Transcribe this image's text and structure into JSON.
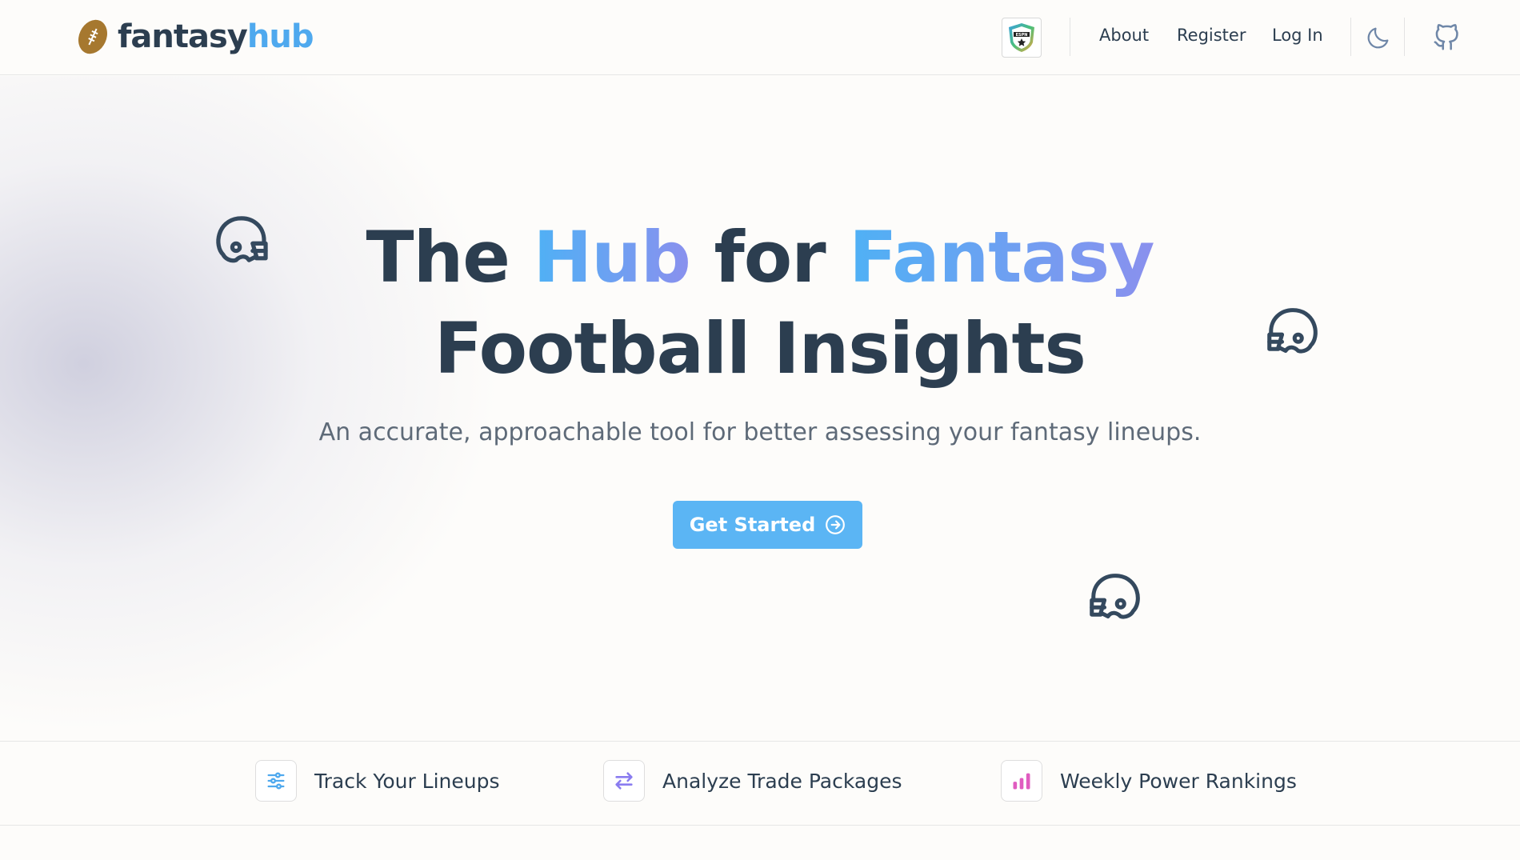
{
  "brand": {
    "name_part1": "fantasy",
    "name_part2": "hub"
  },
  "nav": {
    "links": [
      {
        "label": "About"
      },
      {
        "label": "Register"
      },
      {
        "label": "Log In"
      }
    ],
    "espn_icon": "espn-fantasy-shield-icon",
    "theme_icon": "moon-icon",
    "github_icon": "github-icon"
  },
  "hero": {
    "title_w1": "The",
    "title_w2": "Hub",
    "title_w3": "for",
    "title_w4": "Fantasy",
    "title_line2": "Football Insights",
    "subtitle": "An accurate, approachable tool for better assessing your fantasy lineups.",
    "cta_label": "Get Started",
    "cta_icon": "arrow-right-circle-icon",
    "decor_icons": [
      "football-helmet-icon",
      "football-helmet-icon",
      "football-helmet-icon"
    ]
  },
  "features": [
    {
      "label": "Track Your Lineups",
      "icon": "sliders-icon",
      "color": "#4fa9ee"
    },
    {
      "label": "Analyze Trade Packages",
      "icon": "arrows-swap-icon",
      "color": "#8a7cf0"
    },
    {
      "label": "Weekly Power Rankings",
      "icon": "bar-chart-icon",
      "color": "#e05cc0"
    }
  ],
  "colors": {
    "accent_blue": "#4fa9ee",
    "accent_purple": "#8a90ee",
    "text_dark": "#2c3e50",
    "ball_brown": "#a6782f",
    "cta_bg": "#5bb5f4"
  }
}
